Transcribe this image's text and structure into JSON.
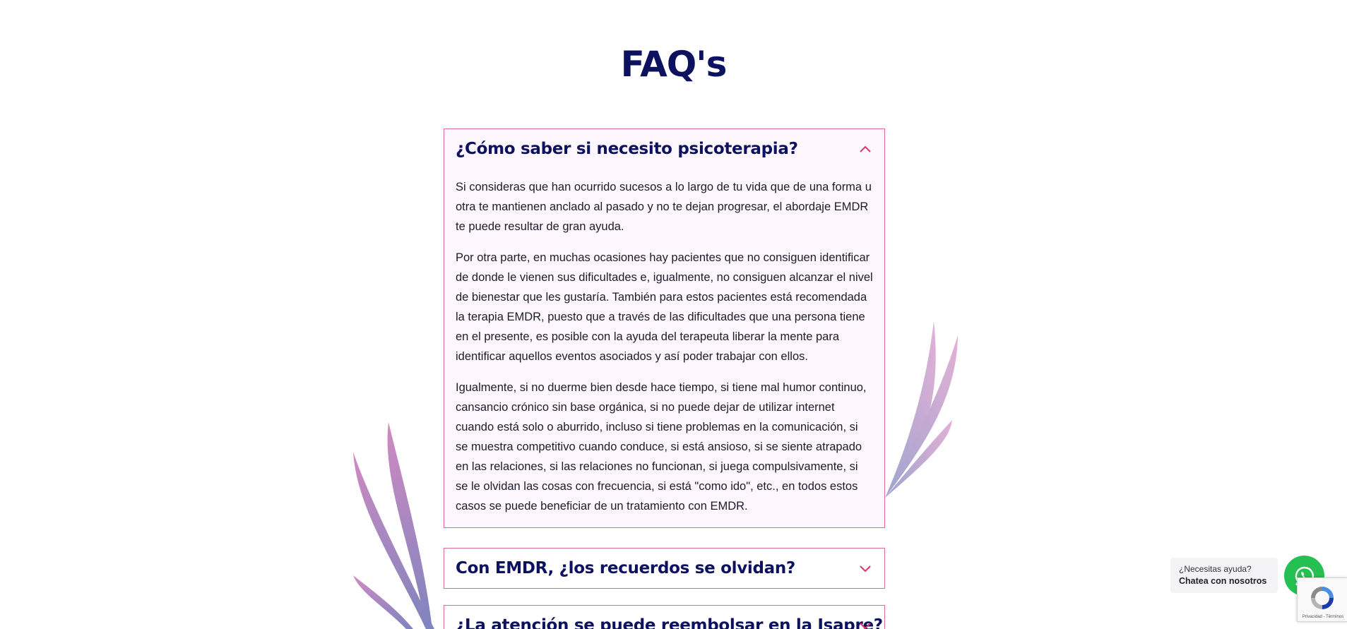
{
  "page": {
    "title": "FAQ's"
  },
  "colors": {
    "navy": "#0c1260",
    "pink": "#e06aa0",
    "whatsapp": "#25c052"
  },
  "faqs": [
    {
      "question": "¿Cómo saber si necesito psicoterapia?",
      "expanded": true,
      "icon": "chevron-up-icon",
      "answer": [
        "Si consideras que han ocurrido sucesos a lo largo de tu vida que de una forma u otra te mantienen anclado al pasado y no te dejan progresar, el abordaje EMDR te puede resultar de gran ayuda.",
        "Por otra parte, en muchas ocasiones hay pacientes que no consiguen identificar de donde le vienen sus dificultades e, igualmente, no consiguen alcanzar el nivel de bienestar que les gustaría. También para estos pacientes está recomendada la terapia EMDR, puesto que a través de las dificultades que una persona tiene en el presente, es posible con la ayuda del terapeuta liberar la mente para identificar aquellos eventos asociados y así poder trabajar con ellos.",
        "Igualmente, si no duerme bien desde hace tiempo, si tiene mal humor continuo, cansancio crónico sin base orgánica, si no puede dejar de utilizar internet cuando está solo o aburrido, incluso si tiene problemas en la comunicación, si se muestra competitivo cuando conduce, si está ansioso, si se siente atrapado en las relaciones, si las relaciones no funcionan, si juega compulsivamente, si se le olvidan las cosas con frecuencia, si está \"como ido\", etc., en todos estos casos se puede beneficiar de un tratamiento con EMDR."
      ]
    },
    {
      "question": "Con EMDR, ¿los recuerdos se olvidan?",
      "expanded": false,
      "icon": "chevron-down-icon"
    },
    {
      "question": "¿La atención se puede reembolsar en la Isapre?",
      "expanded": false,
      "icon": "chevron-down-icon"
    }
  ],
  "chat": {
    "line1": "¿Necesitas ayuda?",
    "line2": "Chatea con nosotros",
    "icon": "whatsapp-icon"
  },
  "recaptcha": {
    "text": "Privacidad - Términos"
  }
}
